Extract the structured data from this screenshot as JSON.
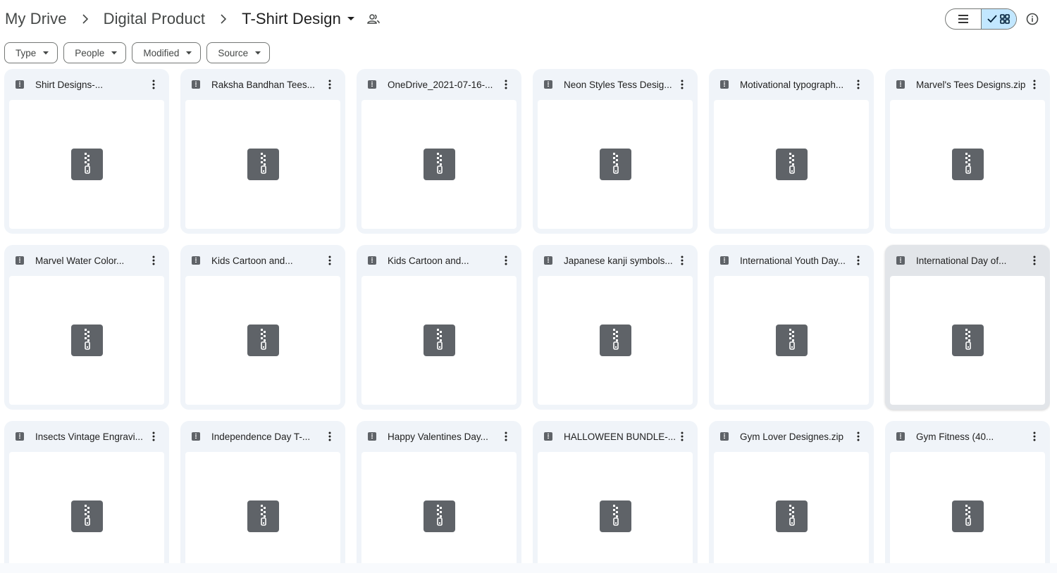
{
  "breadcrumb": {
    "items": [
      "My Drive",
      "Digital Product"
    ],
    "current": "T-Shirt Design"
  },
  "filters": [
    "Type",
    "People",
    "Modified",
    "Source"
  ],
  "view_toggle": {
    "active": "grid"
  },
  "files": [
    "Shirt Designs-...",
    "Raksha Bandhan Tees...",
    "OneDrive_2021-07-16-...",
    "Neon Styles Tess Desig...",
    "Motivational typograph...",
    "Marvel's Tees Designs.zip",
    "Marvel Water Color...",
    "Kids Cartoon and...",
    "Kids Cartoon and...",
    "Japanese kanji symbols...",
    "International Youth Day...",
    "International Day of...",
    "Insects Vintage Engravi...",
    "Independence Day T-...",
    "Happy Valentines Day...",
    "HALLOWEEN BUNDLE-...",
    "Gym Lover Designes.zip",
    "Gym Fitness (40..."
  ],
  "hovered_file_index": 11,
  "icons": {
    "file_type": "zip-file-icon",
    "thumbnail": "zip-archive-icon"
  }
}
